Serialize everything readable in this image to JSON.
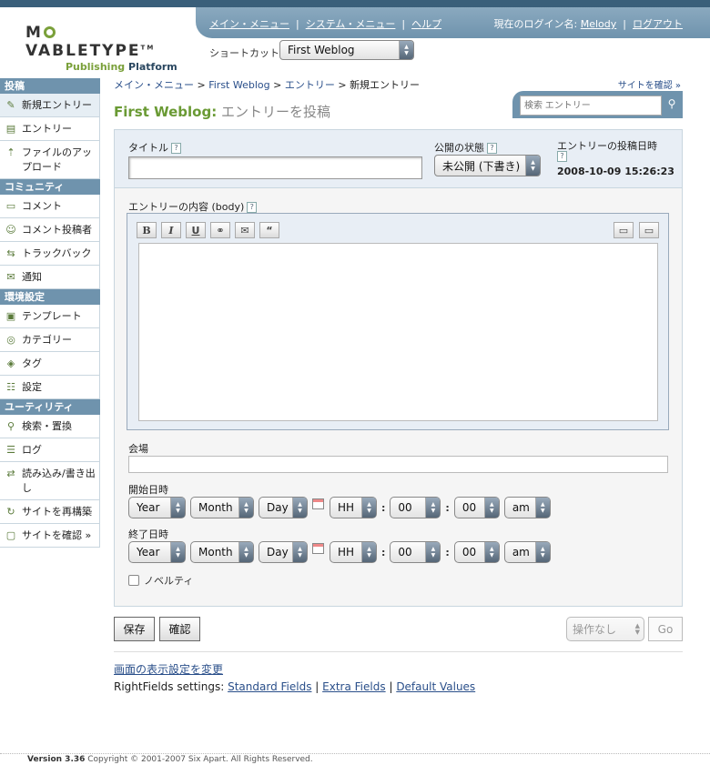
{
  "header": {
    "logo_main_pre": "M",
    "logo_main_post": "VABLETYPE",
    "logo_tm": "TM",
    "logo_sub_a": "Publishing",
    "logo_sub_b": "Platform",
    "nav": [
      "メイン・メニュー",
      "システム・メニュー",
      "ヘルプ"
    ],
    "login_label": "現在のログイン名:",
    "username": "Melody",
    "logout": "ログアウト",
    "shortcut_label": "ショートカット:",
    "shortcut_value": "First Weblog"
  },
  "sidebar": {
    "sections": [
      {
        "title": "投稿",
        "items": [
          {
            "label": "新規エントリー",
            "icon": "pencil-icon",
            "glyph": "✎",
            "active": true
          },
          {
            "label": "エントリー",
            "icon": "documents-icon",
            "glyph": "▤"
          },
          {
            "label": "ファイルのアップロード",
            "icon": "upload-icon",
            "glyph": "⇡"
          }
        ]
      },
      {
        "title": "コミュニティ",
        "items": [
          {
            "label": "コメント",
            "icon": "comment-icon",
            "glyph": "▭"
          },
          {
            "label": "コメント投稿者",
            "icon": "commenter-icon",
            "glyph": "☺"
          },
          {
            "label": "トラックバック",
            "icon": "trackback-icon",
            "glyph": "⇆"
          },
          {
            "label": "通知",
            "icon": "mail-icon",
            "glyph": "✉"
          }
        ]
      },
      {
        "title": "環境設定",
        "items": [
          {
            "label": "テンプレート",
            "icon": "template-icon",
            "glyph": "▣"
          },
          {
            "label": "カテゴリー",
            "icon": "category-icon",
            "glyph": "◎"
          },
          {
            "label": "タグ",
            "icon": "tag-icon",
            "glyph": "◈"
          },
          {
            "label": "設定",
            "icon": "settings-icon",
            "glyph": "☷"
          }
        ]
      },
      {
        "title": "ユーティリティ",
        "items": [
          {
            "label": "検索・置換",
            "icon": "search-icon",
            "glyph": "⚲"
          },
          {
            "label": "ログ",
            "icon": "log-icon",
            "glyph": "☰"
          },
          {
            "label": "読み込み/書き出し",
            "icon": "import-export-icon",
            "glyph": "⇄"
          },
          {
            "label": "サイトを再構築",
            "icon": "rebuild-icon",
            "glyph": "↻"
          },
          {
            "label": "サイトを確認 »",
            "icon": "view-site-icon",
            "glyph": "▢"
          }
        ]
      }
    ]
  },
  "breadcrumb": {
    "main": "メイン・メニュー",
    "blog": "First Weblog",
    "entries": "エントリー",
    "current": "新規エントリー",
    "sep": ">"
  },
  "view_site": "サイトを確認 »",
  "page_title": {
    "blog": "First Weblog:",
    "title": "エントリーを投稿"
  },
  "search": {
    "placeholder": "検索 エントリー"
  },
  "form": {
    "title_label": "タイトル",
    "title_value": "",
    "status_label": "公開の状態",
    "status_value": "未公開 (下書き)",
    "date_label": "エントリーの投稿日時",
    "date_value": "2008-10-09 15:26:23",
    "body_label": "エントリーの内容 (body)",
    "help": "?",
    "toolbar": [
      "B",
      "I",
      "U",
      "⚭",
      "✉",
      "“"
    ],
    "venue_label": "会場",
    "start_label": "開始日時",
    "end_label": "終了日時",
    "dt": {
      "year": "Year",
      "month": "Month",
      "day": "Day",
      "hour": "HH",
      "min": "00",
      "sec": "00",
      "ampm": "am",
      "colon": ":"
    },
    "novelty_label": "ノベルティ"
  },
  "actions": {
    "save": "保存",
    "preview": "確認",
    "action_select": "操作なし",
    "go": "Go"
  },
  "links": {
    "display_settings": "画面の表示設定を変更",
    "rf_label": "RightFields settings:",
    "rf_items": [
      "Standard Fields",
      "Extra Fields",
      "Default Values"
    ],
    "sep": "|"
  },
  "footer": {
    "version": "Version 3.36",
    "copyright": "Copyright © 2001-2007 Six Apart. All Rights Reserved."
  }
}
